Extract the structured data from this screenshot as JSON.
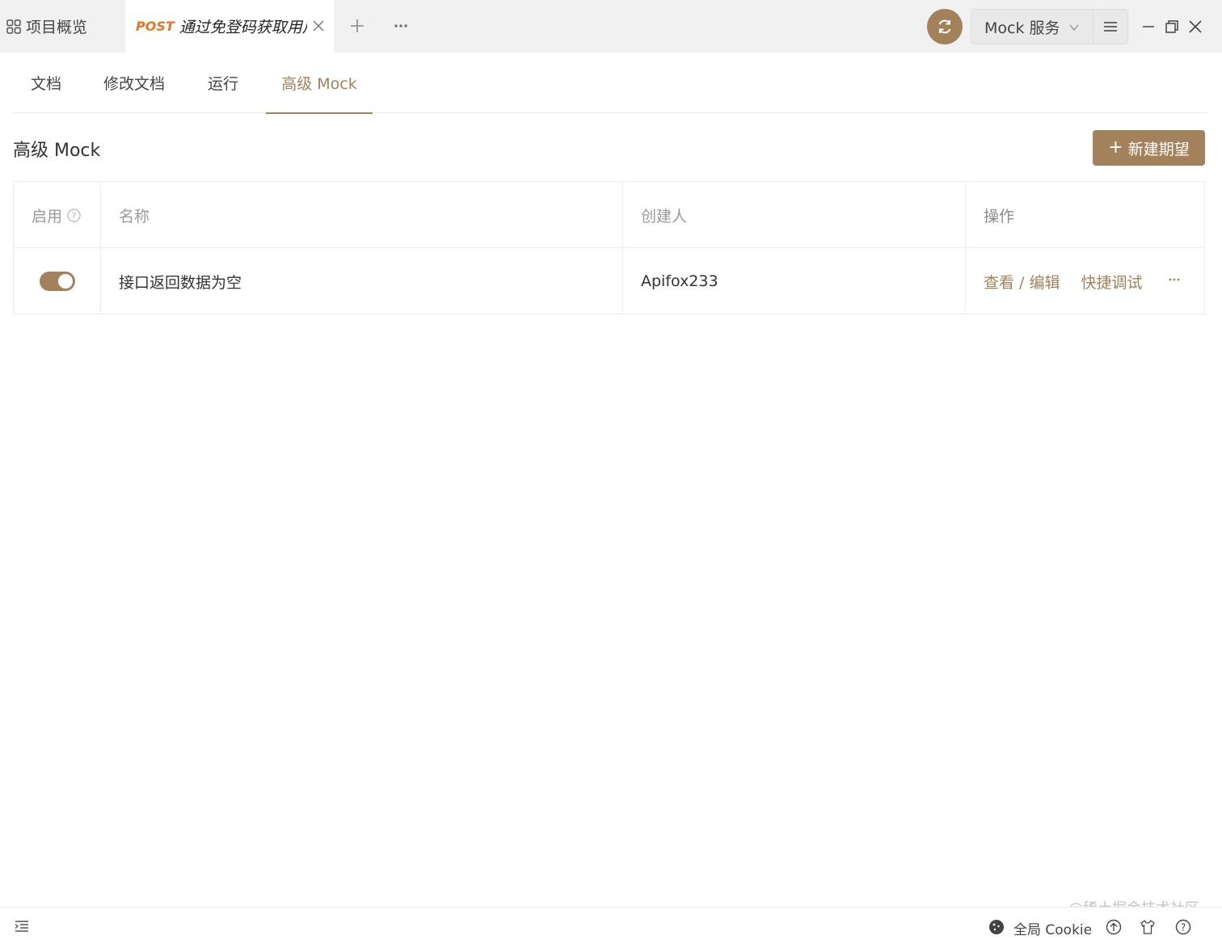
{
  "topbar": {
    "overview_tab_label": "项目概览",
    "active_tab": {
      "method": "POST",
      "title": "通过免登码获取用户信息"
    },
    "environment_select": "Mock 服务"
  },
  "subtabs": [
    {
      "label": "文档",
      "active": false
    },
    {
      "label": "修改文档",
      "active": false
    },
    {
      "label": "运行",
      "active": false
    },
    {
      "label": "高级 Mock",
      "active": true
    }
  ],
  "page": {
    "title": "高级 Mock",
    "new_button": "新建期望"
  },
  "table": {
    "columns": [
      "启用",
      "名称",
      "创建人",
      "操作"
    ],
    "rows": [
      {
        "enabled": true,
        "name": "接口返回数据为空",
        "creator": "Apifox233",
        "actions": [
          "查看 / 编辑",
          "快捷调试"
        ]
      }
    ]
  },
  "footer": {
    "cookie_label": "全局 Cookie"
  },
  "watermark": "@稀土掘金技术社区",
  "colors": {
    "accent": "#a3815b",
    "post_method": "#e8742a",
    "topbar_bg": "#f1f1f2"
  }
}
